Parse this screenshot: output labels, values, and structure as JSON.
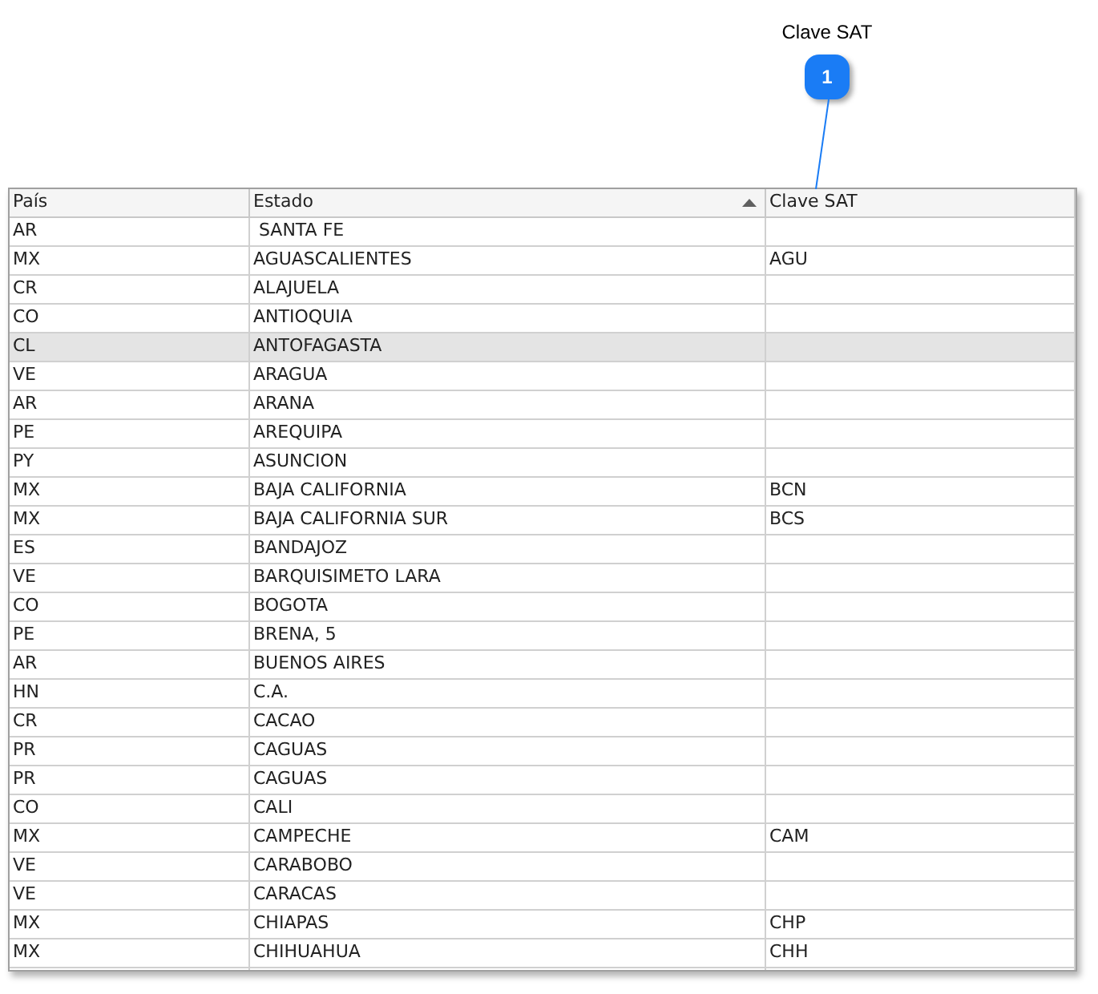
{
  "callout": {
    "label": "Clave SAT",
    "number": "1"
  },
  "table": {
    "columns": [
      {
        "label": "País",
        "sorted": false
      },
      {
        "label": "Estado",
        "sorted": true
      },
      {
        "label": "Clave SAT",
        "sorted": false
      }
    ],
    "rows": [
      {
        "cells": [
          "AR",
          " SANTA FE",
          ""
        ],
        "selected": false
      },
      {
        "cells": [
          "MX",
          "AGUASCALIENTES",
          "AGU"
        ],
        "selected": false
      },
      {
        "cells": [
          "CR",
          "ALAJUELA",
          ""
        ],
        "selected": false
      },
      {
        "cells": [
          "CO",
          "ANTIOQUIA",
          ""
        ],
        "selected": false
      },
      {
        "cells": [
          "CL",
          "ANTOFAGASTA",
          ""
        ],
        "selected": true
      },
      {
        "cells": [
          "VE",
          "ARAGUA",
          ""
        ],
        "selected": false
      },
      {
        "cells": [
          "AR",
          "ARANA",
          ""
        ],
        "selected": false
      },
      {
        "cells": [
          "PE",
          "AREQUIPA",
          ""
        ],
        "selected": false
      },
      {
        "cells": [
          "PY",
          "ASUNCION",
          ""
        ],
        "selected": false
      },
      {
        "cells": [
          "MX",
          "BAJA CALIFORNIA",
          "BCN"
        ],
        "selected": false
      },
      {
        "cells": [
          "MX",
          "BAJA CALIFORNIA SUR",
          "BCS"
        ],
        "selected": false
      },
      {
        "cells": [
          "ES",
          "BANDAJOZ",
          ""
        ],
        "selected": false
      },
      {
        "cells": [
          "VE",
          "BARQUISIMETO LARA",
          ""
        ],
        "selected": false
      },
      {
        "cells": [
          "CO",
          "BOGOTA",
          ""
        ],
        "selected": false
      },
      {
        "cells": [
          "PE",
          "BRENA, 5",
          ""
        ],
        "selected": false
      },
      {
        "cells": [
          "AR",
          "BUENOS AIRES",
          ""
        ],
        "selected": false
      },
      {
        "cells": [
          "HN",
          "C.A.",
          ""
        ],
        "selected": false
      },
      {
        "cells": [
          "CR",
          "CACAO",
          ""
        ],
        "selected": false
      },
      {
        "cells": [
          "PR",
          "CAGUAS",
          ""
        ],
        "selected": false
      },
      {
        "cells": [
          "PR",
          "CAGUAS",
          ""
        ],
        "selected": false
      },
      {
        "cells": [
          "CO",
          "CALI",
          ""
        ],
        "selected": false
      },
      {
        "cells": [
          "MX",
          "CAMPECHE",
          "CAM"
        ],
        "selected": false
      },
      {
        "cells": [
          "VE",
          "CARABOBO",
          ""
        ],
        "selected": false
      },
      {
        "cells": [
          "VE",
          "CARACAS",
          ""
        ],
        "selected": false
      },
      {
        "cells": [
          "MX",
          "CHIAPAS",
          "CHP"
        ],
        "selected": false
      },
      {
        "cells": [
          "MX",
          "CHIHUAHUA",
          "CHH"
        ],
        "selected": false
      }
    ]
  }
}
